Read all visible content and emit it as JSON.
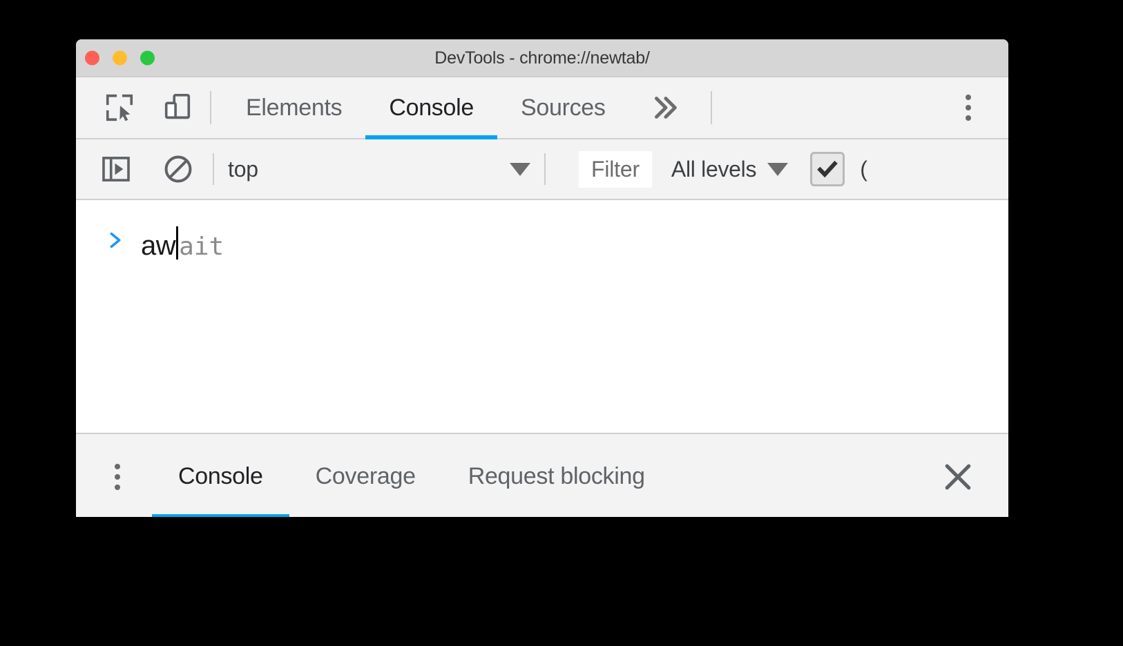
{
  "window": {
    "title": "DevTools - chrome://newtab/",
    "traffic_lights": [
      {
        "name": "close",
        "color": "#ff5f57"
      },
      {
        "name": "minimize",
        "color": "#ffbd2e"
      },
      {
        "name": "maximize",
        "color": "#28c840"
      }
    ]
  },
  "theme": {
    "accent": "#03a4f0",
    "titlebar_bg": "#d6d6d6",
    "toolbar_bg": "#f3f3f3",
    "panel_bg": "#ffffff",
    "text_primary": "#202124",
    "text_secondary": "#5f6368",
    "suggestion_gray": "#8a8a8a"
  },
  "main_toolbar": {
    "inspect_icon": "inspect-element-icon",
    "device_toolbar_icon": "device-toolbar-icon",
    "overflow_icon": "more-tabs-chevrons-icon",
    "menu_icon": "kebab-menu-icon",
    "tabs": [
      {
        "label": "Elements",
        "selected": false
      },
      {
        "label": "Console",
        "selected": true
      },
      {
        "label": "Sources",
        "selected": false
      }
    ]
  },
  "console_toolbar": {
    "sidebar_toggle_icon": "console-sidebar-toggle-icon",
    "clear_console_icon": "clear-console-icon",
    "context": {
      "value": "top",
      "caret_icon": "chevron-down-icon"
    },
    "filter": {
      "placeholder": "Filter",
      "value": ""
    },
    "levels": {
      "value": "All levels",
      "caret_icon": "chevron-down-icon"
    },
    "group_similar": {
      "checked": true,
      "label": "("
    }
  },
  "console_body": {
    "prompt_icon": "prompt-chevron-icon",
    "typed_text": "aw",
    "suggestion_text": "ait",
    "full_text": "await"
  },
  "drawer": {
    "menu_icon": "kebab-menu-icon",
    "close_icon": "close-icon",
    "tabs": [
      {
        "label": "Console",
        "selected": true
      },
      {
        "label": "Coverage",
        "selected": false
      },
      {
        "label": "Request blocking",
        "selected": false
      }
    ]
  }
}
